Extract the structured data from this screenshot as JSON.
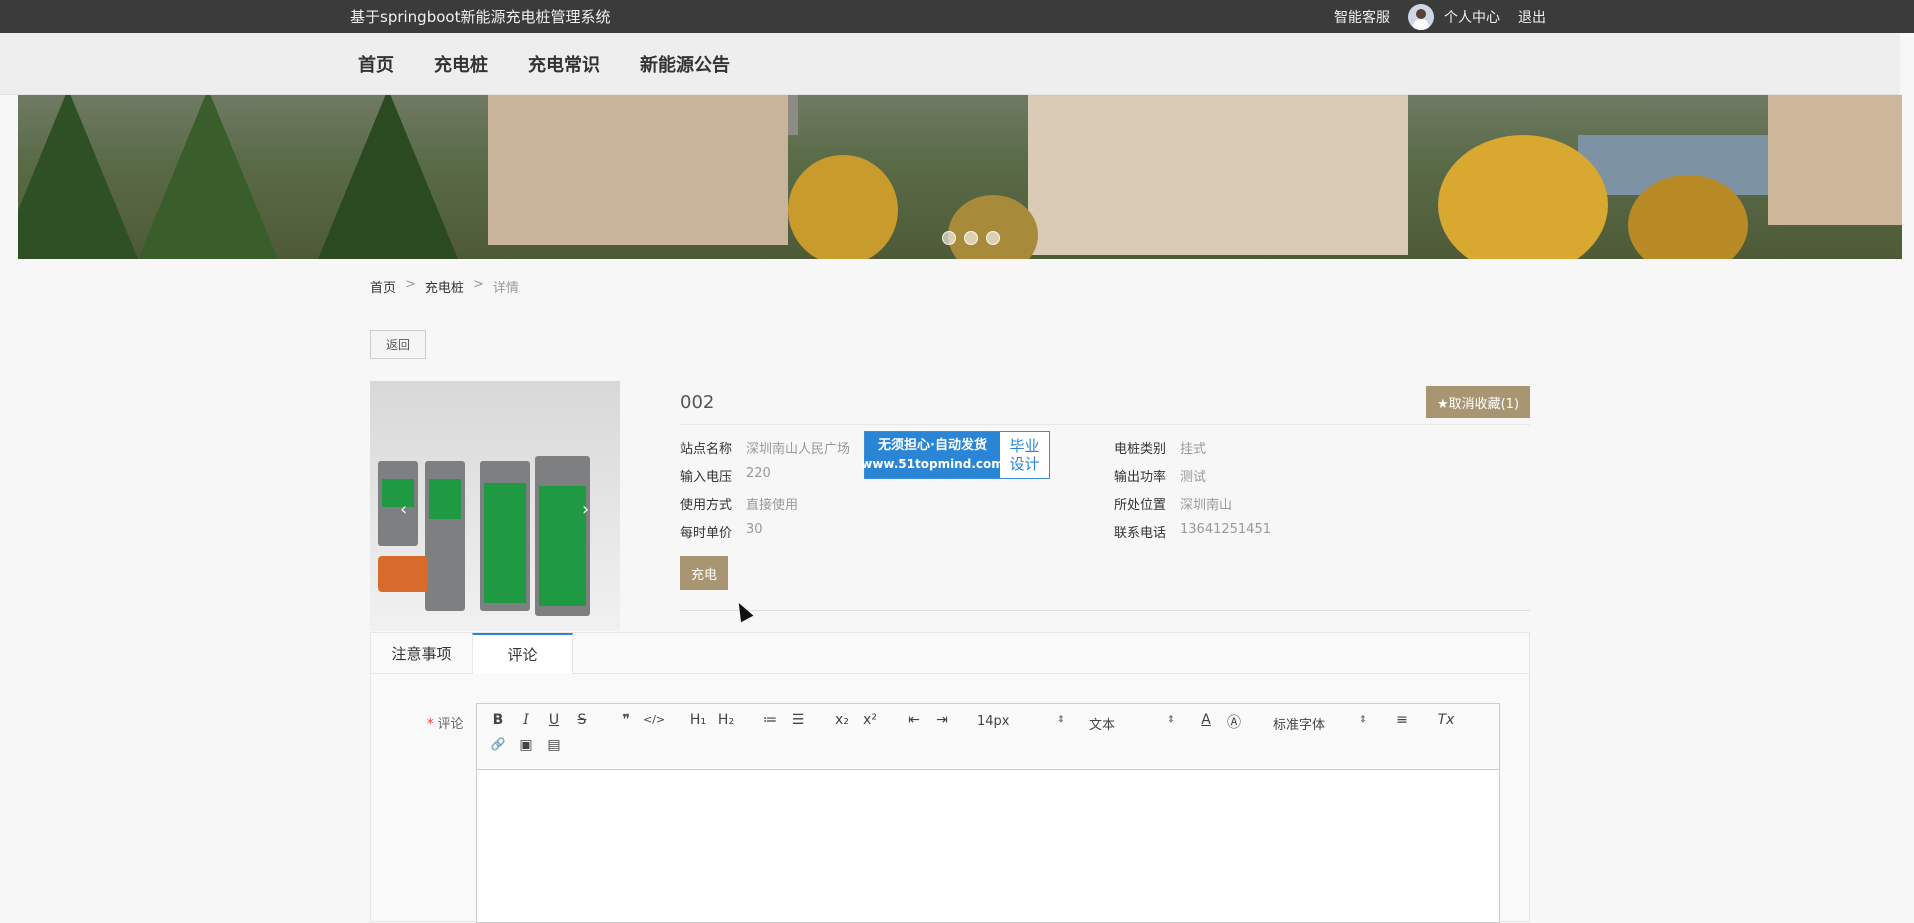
{
  "topbar": {
    "system_title": "基于springboot新能源充电桩管理系统",
    "smart_service": "智能客服",
    "personal_center": "个人中心",
    "logout": "退出"
  },
  "nav": [
    "首页",
    "充电桩",
    "充电常识",
    "新能源公告"
  ],
  "breadcrumb": {
    "home": "首页",
    "separator": ">",
    "section": "充电桩",
    "current": "详情"
  },
  "back_button": "返回",
  "product": {
    "title": "002",
    "favorite_button": "★取消收藏(1)",
    "charge_button": "充电",
    "left_fields": [
      {
        "label": "站点名称",
        "value": "深圳南山人民广场"
      },
      {
        "label": "输入电压",
        "value": "220"
      },
      {
        "label": "使用方式",
        "value": "直接使用"
      },
      {
        "label": "每时单价",
        "value": "30"
      }
    ],
    "right_fields": [
      {
        "label": "电桩类别",
        "value": "挂式"
      },
      {
        "label": "输出功率",
        "value": "测试"
      },
      {
        "label": "所处位置",
        "value": "深圳南山"
      },
      {
        "label": "联系电话",
        "value": "13641251451"
      }
    ],
    "image_prev": "‹",
    "image_next": "›"
  },
  "watermark": {
    "line1": "无须担心·自动发货",
    "url": "www.51topmind.com",
    "right_line1": "毕业",
    "right_line2": "设计"
  },
  "tabs": [
    "注意事项",
    "评论"
  ],
  "active_tab": "评论",
  "comment": {
    "required_mark": "*",
    "label": "评论",
    "toolbar": {
      "bold": "B",
      "italic": "I",
      "underline": "U",
      "strike": "S",
      "quote": "❞",
      "code": "</>",
      "h1": "H₁",
      "h2": "H₂",
      "ordered_list": "≔",
      "bullet_list": "☰",
      "subscript": "x₂",
      "superscript": "x²",
      "outdent": "⇤",
      "indent": "⇥",
      "size_value": "14px",
      "size_arrow": "⇕",
      "header_value": "文本",
      "header_arrow": "⇕",
      "color": "A",
      "background": "Ⓐ",
      "font_value": "标准字体",
      "font_arrow": "⇕",
      "align": "≡",
      "clean": "Tx",
      "link": "🔗",
      "image": "▣",
      "video": "▤"
    }
  },
  "colors": {
    "topbar_bg": "#3b3b3b",
    "accent_button": "#a89672",
    "active_tab_border": "#2a86d4"
  }
}
